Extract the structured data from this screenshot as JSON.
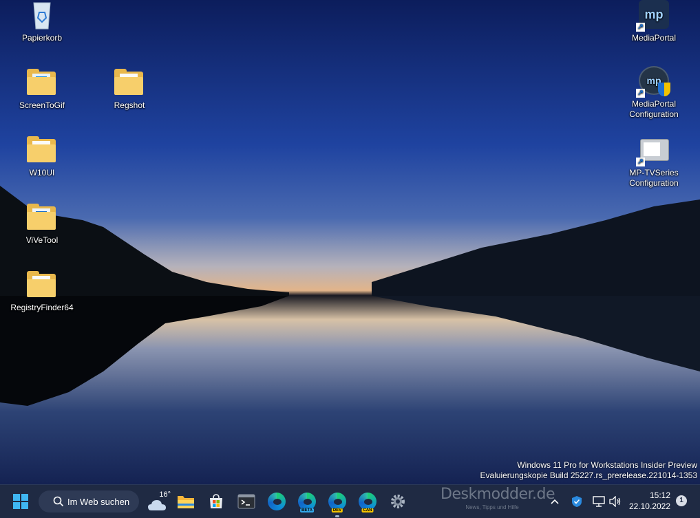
{
  "desktop": {
    "icons": [
      {
        "label": "Papierkorb",
        "icon": "recycle-bin-icon"
      },
      {
        "label": "ScreenToGif",
        "icon": "folder-icon"
      },
      {
        "label": "Regshot",
        "icon": "folder-icon"
      },
      {
        "label": "W10UI",
        "icon": "folder-icon"
      },
      {
        "label": "ViVeTool",
        "icon": "folder-icon"
      },
      {
        "label": "RegistryFinder64",
        "icon": "folder-icon"
      },
      {
        "label": "MediaPortal",
        "icon": "mediaportal-icon"
      },
      {
        "label_line1": "MediaPortal",
        "label_line2": "Configuration",
        "icon": "mediaportal-config-icon"
      },
      {
        "label_line1": "MP-TVSeries",
        "label_line2": "Configuration",
        "icon": "tvseries-config-icon"
      }
    ]
  },
  "watermark": {
    "line1": "Windows 11 Pro for Workstations Insider Preview",
    "line2": "Evaluierungskopie Build 25227.rs_prerelease.221014-1353"
  },
  "taskbar": {
    "search_label": "Im Web suchen",
    "weather_temp": "16°",
    "edge_badges": [
      "BETA",
      "DEV",
      "CAN"
    ],
    "brand_watermark": "Deskmodder.de",
    "brand_tagline": "News, Tipps und Hilfe",
    "clock_time": "15:12",
    "clock_date": "22.10.2022",
    "notification_count": "1"
  },
  "colors": {
    "taskbar_bg": "#1f2a43",
    "accent": "#0078d4"
  }
}
